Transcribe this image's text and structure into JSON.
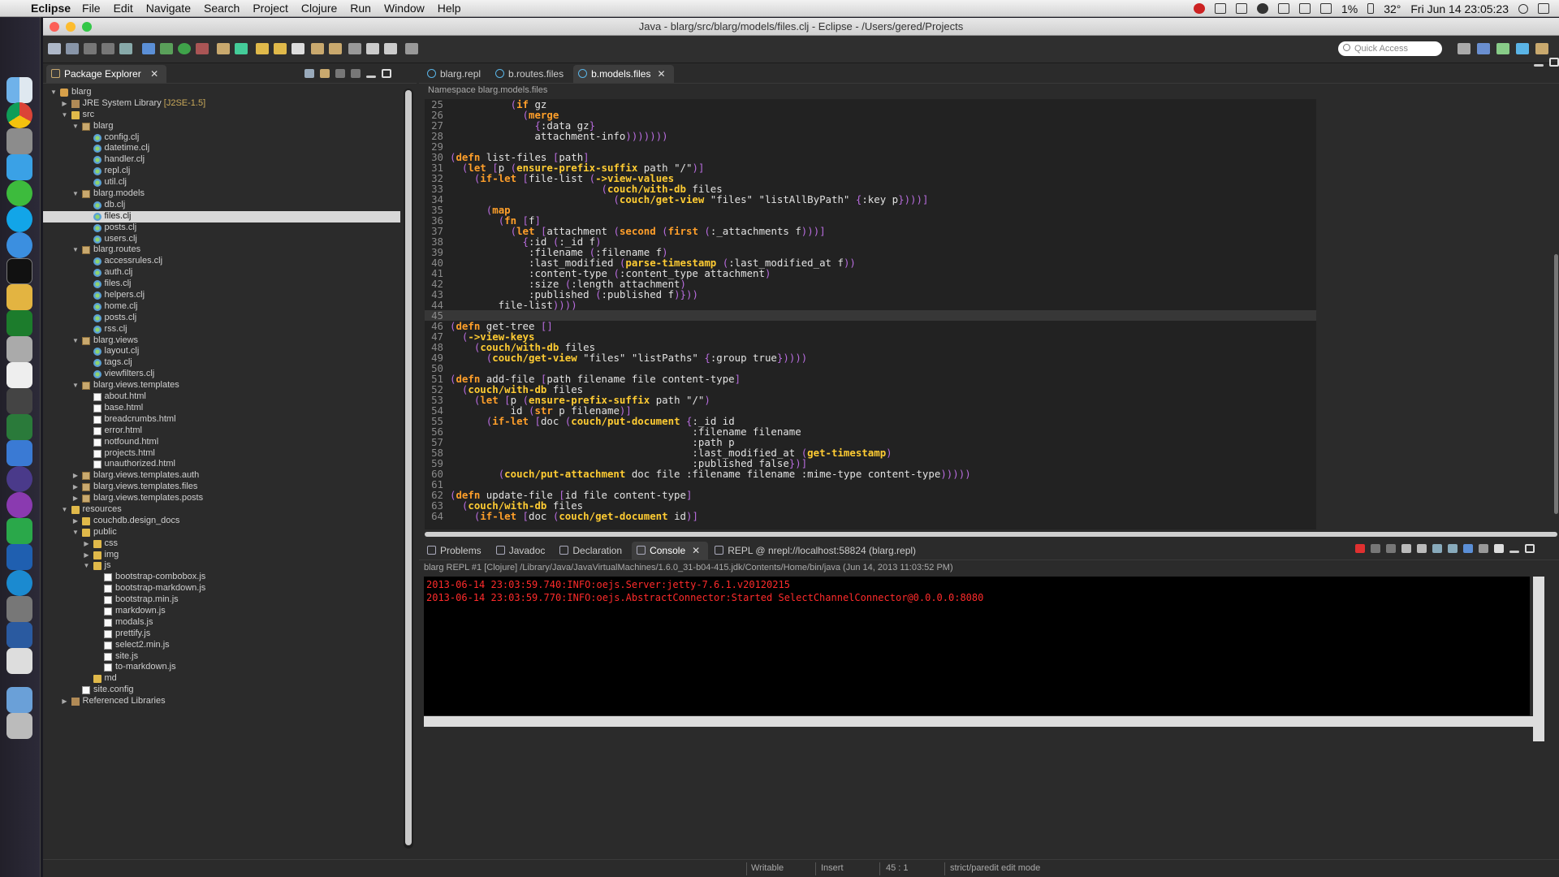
{
  "menubar": {
    "app": "Eclipse",
    "items": [
      "File",
      "Edit",
      "Navigate",
      "Search",
      "Project",
      "Clojure",
      "Run",
      "Window",
      "Help"
    ],
    "battery": "1%",
    "temperature": "32°",
    "clock": "Fri Jun 14  23:05:23"
  },
  "window": {
    "title": "Java - blarg/src/blarg/models/files.clj - Eclipse - /Users/gered/Projects"
  },
  "toolbar": {
    "quick_access_placeholder": "Quick Access"
  },
  "package_explorer": {
    "tab_label": "Package Explorer",
    "close": "✕",
    "tree": [
      {
        "label": "blarg",
        "depth": 0,
        "twisty": "▼",
        "icon": "proj"
      },
      {
        "label": "JRE System Library",
        "decoration": "[J2SE-1.5]",
        "depth": 1,
        "twisty": "▶",
        "icon": "lib"
      },
      {
        "label": "src",
        "depth": 1,
        "twisty": "▼",
        "icon": "fold"
      },
      {
        "label": "blarg",
        "depth": 2,
        "twisty": "▼",
        "icon": "pkg"
      },
      {
        "label": "config.clj",
        "depth": 3,
        "icon": "clj"
      },
      {
        "label": "datetime.clj",
        "depth": 3,
        "icon": "clj"
      },
      {
        "label": "handler.clj",
        "depth": 3,
        "icon": "clj"
      },
      {
        "label": "repl.clj",
        "depth": 3,
        "icon": "clj"
      },
      {
        "label": "util.clj",
        "depth": 3,
        "icon": "clj"
      },
      {
        "label": "blarg.models",
        "depth": 2,
        "twisty": "▼",
        "icon": "pkg"
      },
      {
        "label": "db.clj",
        "depth": 3,
        "icon": "clj"
      },
      {
        "label": "files.clj",
        "depth": 3,
        "icon": "clj",
        "selected": true
      },
      {
        "label": "posts.clj",
        "depth": 3,
        "icon": "clj"
      },
      {
        "label": "users.clj",
        "depth": 3,
        "icon": "clj"
      },
      {
        "label": "blarg.routes",
        "depth": 2,
        "twisty": "▼",
        "icon": "pkg"
      },
      {
        "label": "accessrules.clj",
        "depth": 3,
        "icon": "clj"
      },
      {
        "label": "auth.clj",
        "depth": 3,
        "icon": "clj"
      },
      {
        "label": "files.clj",
        "depth": 3,
        "icon": "clj"
      },
      {
        "label": "helpers.clj",
        "depth": 3,
        "icon": "clj"
      },
      {
        "label": "home.clj",
        "depth": 3,
        "icon": "clj"
      },
      {
        "label": "posts.clj",
        "depth": 3,
        "icon": "clj"
      },
      {
        "label": "rss.clj",
        "depth": 3,
        "icon": "clj"
      },
      {
        "label": "blarg.views",
        "depth": 2,
        "twisty": "▼",
        "icon": "pkg"
      },
      {
        "label": "layout.clj",
        "depth": 3,
        "icon": "clj"
      },
      {
        "label": "tags.clj",
        "depth": 3,
        "icon": "clj"
      },
      {
        "label": "viewfilters.clj",
        "depth": 3,
        "icon": "clj"
      },
      {
        "label": "blarg.views.templates",
        "depth": 2,
        "twisty": "▼",
        "icon": "pkg"
      },
      {
        "label": "about.html",
        "depth": 3,
        "icon": "file"
      },
      {
        "label": "base.html",
        "depth": 3,
        "icon": "file"
      },
      {
        "label": "breadcrumbs.html",
        "depth": 3,
        "icon": "file"
      },
      {
        "label": "error.html",
        "depth": 3,
        "icon": "file"
      },
      {
        "label": "notfound.html",
        "depth": 3,
        "icon": "file"
      },
      {
        "label": "projects.html",
        "depth": 3,
        "icon": "file"
      },
      {
        "label": "unauthorized.html",
        "depth": 3,
        "icon": "file"
      },
      {
        "label": "blarg.views.templates.auth",
        "depth": 2,
        "twisty": "▶",
        "icon": "pkg"
      },
      {
        "label": "blarg.views.templates.files",
        "depth": 2,
        "twisty": "▶",
        "icon": "pkg"
      },
      {
        "label": "blarg.views.templates.posts",
        "depth": 2,
        "twisty": "▶",
        "icon": "pkg"
      },
      {
        "label": "resources",
        "depth": 1,
        "twisty": "▼",
        "icon": "fold"
      },
      {
        "label": "couchdb.design_docs",
        "depth": 2,
        "twisty": "▶",
        "icon": "fold"
      },
      {
        "label": "public",
        "depth": 2,
        "twisty": "▼",
        "icon": "fold"
      },
      {
        "label": "css",
        "depth": 3,
        "twisty": "▶",
        "icon": "fold"
      },
      {
        "label": "img",
        "depth": 3,
        "twisty": "▶",
        "icon": "fold"
      },
      {
        "label": "js",
        "depth": 3,
        "twisty": "▼",
        "icon": "fold"
      },
      {
        "label": "bootstrap-combobox.js",
        "depth": 4,
        "icon": "file"
      },
      {
        "label": "bootstrap-markdown.js",
        "depth": 4,
        "icon": "file"
      },
      {
        "label": "bootstrap.min.js",
        "depth": 4,
        "icon": "file"
      },
      {
        "label": "markdown.js",
        "depth": 4,
        "icon": "file"
      },
      {
        "label": "modals.js",
        "depth": 4,
        "icon": "file"
      },
      {
        "label": "prettify.js",
        "depth": 4,
        "icon": "file"
      },
      {
        "label": "select2.min.js",
        "depth": 4,
        "icon": "file"
      },
      {
        "label": "site.js",
        "depth": 4,
        "icon": "file"
      },
      {
        "label": "to-markdown.js",
        "depth": 4,
        "icon": "file"
      },
      {
        "label": "md",
        "depth": 3,
        "icon": "fold"
      },
      {
        "label": "site.config",
        "depth": 2,
        "icon": "file"
      },
      {
        "label": "Referenced Libraries",
        "depth": 1,
        "twisty": "▶",
        "icon": "lib"
      }
    ]
  },
  "editor": {
    "tabs": [
      {
        "label": "blarg.repl",
        "active": false
      },
      {
        "label": "b.routes.files",
        "active": false
      },
      {
        "label": "b.models.files",
        "active": true
      }
    ],
    "close": "✕",
    "namespace_bar": "Namespace blarg.models.files",
    "current_line": 45,
    "lines": [
      {
        "n": 25,
        "t": "          (if gz"
      },
      {
        "n": 26,
        "t": "            (merge"
      },
      {
        "n": 27,
        "t": "              {:data gz}"
      },
      {
        "n": 28,
        "t": "              attachment-info)))))))"
      },
      {
        "n": 29,
        "t": ""
      },
      {
        "n": 30,
        "t": "(defn list-files [path]"
      },
      {
        "n": 31,
        "t": "  (let [p (ensure-prefix-suffix path \"/\")]"
      },
      {
        "n": 32,
        "t": "    (if-let [file-list (->view-values"
      },
      {
        "n": 33,
        "t": "                         (couch/with-db files"
      },
      {
        "n": 34,
        "t": "                           (couch/get-view \"files\" \"listAllByPath\" {:key p})))]"
      },
      {
        "n": 35,
        "t": "      (map"
      },
      {
        "n": 36,
        "t": "        (fn [f]"
      },
      {
        "n": 37,
        "t": "          (let [attachment (second (first (:_attachments f)))]"
      },
      {
        "n": 38,
        "t": "            {:id (:_id f)"
      },
      {
        "n": 39,
        "t": "             :filename (:filename f)"
      },
      {
        "n": 40,
        "t": "             :last_modified (parse-timestamp (:last_modified_at f))"
      },
      {
        "n": 41,
        "t": "             :content-type (:content_type attachment)"
      },
      {
        "n": 42,
        "t": "             :size (:length attachment)"
      },
      {
        "n": 43,
        "t": "             :published (:published f)}))"
      },
      {
        "n": 44,
        "t": "        file-list))))"
      },
      {
        "n": 45,
        "t": ""
      },
      {
        "n": 46,
        "t": "(defn get-tree []"
      },
      {
        "n": 47,
        "t": "  (->view-keys"
      },
      {
        "n": 48,
        "t": "    (couch/with-db files"
      },
      {
        "n": 49,
        "t": "      (couch/get-view \"files\" \"listPaths\" {:group true}))))"
      },
      {
        "n": 50,
        "t": ""
      },
      {
        "n": 51,
        "t": "(defn add-file [path filename file content-type]"
      },
      {
        "n": 52,
        "t": "  (couch/with-db files"
      },
      {
        "n": 53,
        "t": "    (let [p (ensure-prefix-suffix path \"/\")"
      },
      {
        "n": 54,
        "t": "          id (str p filename)]"
      },
      {
        "n": 55,
        "t": "      (if-let [doc (couch/put-document {:_id id"
      },
      {
        "n": 56,
        "t": "                                        :filename filename"
      },
      {
        "n": 57,
        "t": "                                        :path p"
      },
      {
        "n": 58,
        "t": "                                        :last_modified_at (get-timestamp)"
      },
      {
        "n": 59,
        "t": "                                        :published false})]"
      },
      {
        "n": 60,
        "t": "        (couch/put-attachment doc file :filename filename :mime-type content-type)))))"
      },
      {
        "n": 61,
        "t": ""
      },
      {
        "n": 62,
        "t": "(defn update-file [id file content-type]"
      },
      {
        "n": 63,
        "t": "  (couch/with-db files"
      },
      {
        "n": 64,
        "t": "    (if-let [doc (couch/get-document id)]"
      }
    ]
  },
  "bottom_panel": {
    "tabs": [
      {
        "label": "Problems",
        "active": false
      },
      {
        "label": "Javadoc",
        "active": false
      },
      {
        "label": "Declaration",
        "active": false
      },
      {
        "label": "Console",
        "active": true
      },
      {
        "label": "REPL @ nrepl://localhost:58824 (blarg.repl)",
        "active": false
      }
    ],
    "close": "✕",
    "console_header": "blarg REPL #1 [Clojure] /Library/Java/JavaVirtualMachines/1.6.0_31-b04-415.jdk/Contents/Home/bin/java (Jun 14, 2013 11:03:52 PM)",
    "console_lines": [
      "2013-06-14 23:03:59.740:INFO:oejs.Server:jetty-7.6.1.v20120215",
      "2013-06-14 23:03:59.770:INFO:oejs.AbstractConnector:Started SelectChannelConnector@0.0.0.0:8080"
    ],
    "console_color": "#ff2b2b"
  },
  "statusbar": {
    "writable": "Writable",
    "insert": "Insert",
    "position": "45 : 1",
    "mode": "strict/paredit edit mode"
  }
}
